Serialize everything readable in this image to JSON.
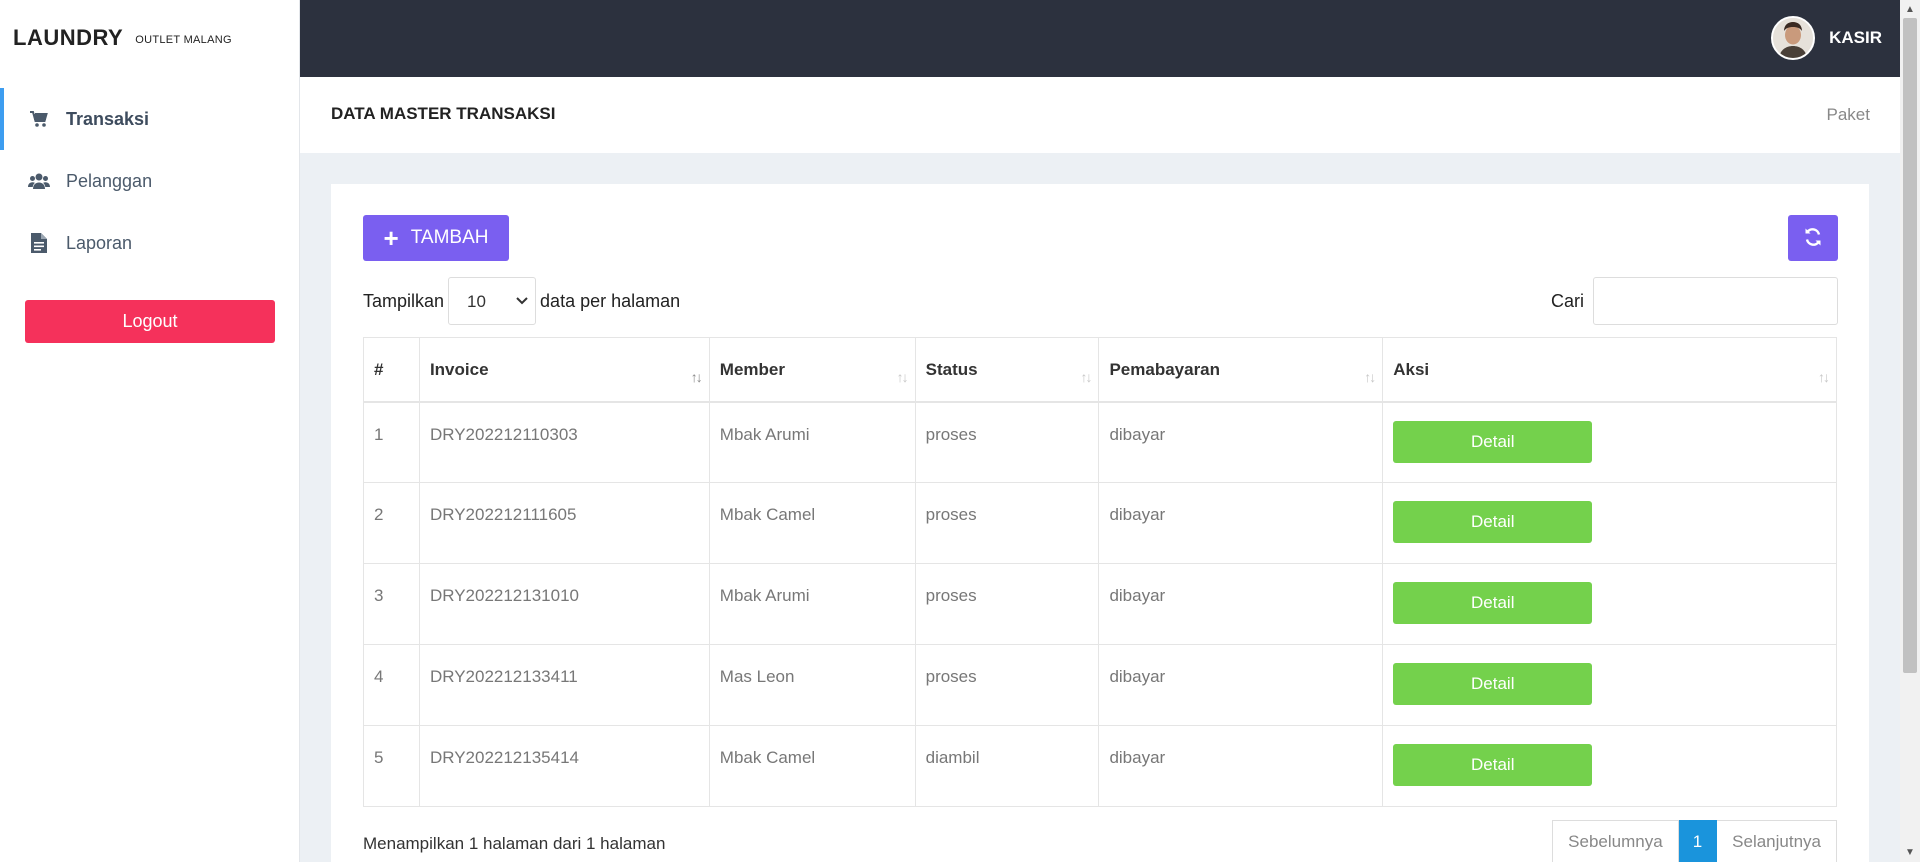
{
  "brand": {
    "title": "LAUNDRY",
    "subtitle": "OUTLET MALANG"
  },
  "sidebar": {
    "items": [
      {
        "label": "Transaksi",
        "icon": "cart-icon",
        "active": true
      },
      {
        "label": "Pelanggan",
        "icon": "users-icon",
        "active": false
      },
      {
        "label": "Laporan",
        "icon": "file-icon",
        "active": false
      }
    ],
    "logout_label": "Logout"
  },
  "topbar": {
    "user_name": "KASIR",
    "avatar_icon": "user-avatar"
  },
  "header": {
    "title": "DATA MASTER TRANSAKSI",
    "breadcrumb": "Paket"
  },
  "toolbar": {
    "add_label": "TAMBAH",
    "refresh_icon": "refresh-icon"
  },
  "length": {
    "prefix": "Tampilkan",
    "selected": "10",
    "suffix": "data per halaman"
  },
  "search": {
    "label": "Cari",
    "value": ""
  },
  "table": {
    "headers": [
      "#",
      "Invoice",
      "Member",
      "Status",
      "Pemabayaran",
      "Aksi"
    ],
    "rows": [
      {
        "no": "1",
        "invoice": "DRY202212110303",
        "member": "Mbak Arumi",
        "status": "proses",
        "payment": "dibayar",
        "action": "Detail"
      },
      {
        "no": "2",
        "invoice": "DRY202212111605",
        "member": "Mbak Camel",
        "status": "proses",
        "payment": "dibayar",
        "action": "Detail"
      },
      {
        "no": "3",
        "invoice": "DRY202212131010",
        "member": "Mbak Arumi",
        "status": "proses",
        "payment": "dibayar",
        "action": "Detail"
      },
      {
        "no": "4",
        "invoice": "DRY202212133411",
        "member": "Mas Leon",
        "status": "proses",
        "payment": "dibayar",
        "action": "Detail"
      },
      {
        "no": "5",
        "invoice": "DRY202212135414",
        "member": "Mbak Camel",
        "status": "diambil",
        "payment": "dibayar",
        "action": "Detail"
      }
    ]
  },
  "footer": {
    "info": "Menampilkan 1 halaman dari 1 halaman"
  },
  "pagination": {
    "prev": "Sebelumnya",
    "current": "1",
    "next": "Selanjutnya"
  },
  "colors": {
    "accent": "#7a5ff0",
    "danger": "#f5315b",
    "success": "#74d14c",
    "topbar": "#2c313e",
    "active_page": "#1a94dc"
  }
}
